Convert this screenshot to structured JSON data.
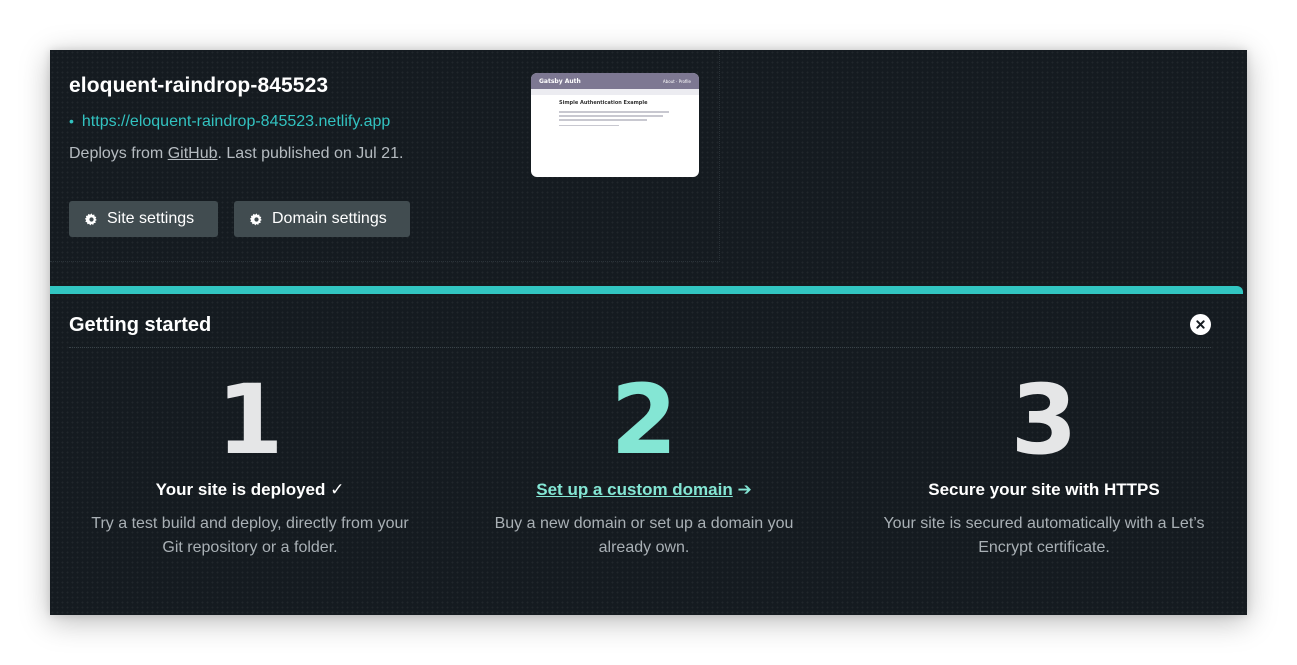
{
  "site": {
    "name": "eloquent-raindrop-845523",
    "url": "https://eloquent-raindrop-845523.netlify.app",
    "deploy_prefix": "Deploys from ",
    "deploy_source": "GitHub",
    "deploy_suffix": ". Last published on Jul 21."
  },
  "buttons": {
    "site_settings": "Site settings",
    "domain_settings": "Domain settings"
  },
  "preview": {
    "title": "Gatsby Auth",
    "nav": "About · Profile",
    "heading": "Simple Authentication Example"
  },
  "getting_started": {
    "title": "Getting started",
    "steps": [
      {
        "number": "1",
        "title": "Your site is deployed ✓",
        "description": "Try a test build and deploy, directly from your Git repository or a folder."
      },
      {
        "number": "2",
        "title_link": "Set up a custom domain",
        "title_arrow": " ➔",
        "description": "Buy a new domain or set up a domain you already own."
      },
      {
        "number": "3",
        "title": "Secure your site with HTTPS",
        "description": "Your site is secured automatically with a Let’s Encrypt certificate."
      }
    ]
  },
  "colors": {
    "background": "#151b20",
    "accent": "#32c6c2",
    "link": "#32c2c0",
    "step_highlight": "#84e6d4",
    "button": "#414c50"
  }
}
